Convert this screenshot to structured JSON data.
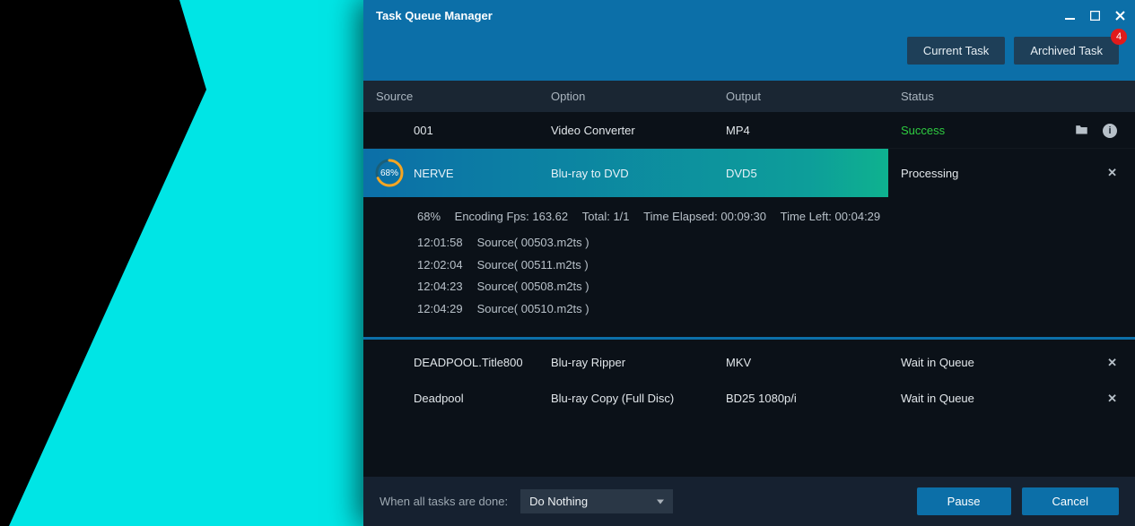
{
  "window": {
    "title": "Task Queue Manager"
  },
  "tabs": {
    "current": "Current Task",
    "archived": "Archived Task",
    "archived_badge": "4"
  },
  "columns": {
    "source": "Source",
    "option": "Option",
    "output": "Output",
    "status": "Status"
  },
  "rows": [
    {
      "source": "001",
      "option": "Video Converter",
      "output": "MP4",
      "status": "Success",
      "status_class": "success",
      "actions": [
        "folder",
        "info"
      ]
    },
    {
      "source": "NERVE",
      "option": "Blu-ray to DVD",
      "output": "DVD5",
      "status": "Processing",
      "processing": true,
      "progress_pct": 68,
      "progress_label": "68%",
      "actions": [
        "close"
      ],
      "details": {
        "stat_pct": "68%",
        "stat_fps": "Encoding Fps: 163.62",
        "stat_total": "Total: 1/1",
        "stat_elapsed": "Time Elapsed: 00:09:30",
        "stat_left": "Time Left: 00:04:29",
        "log": [
          {
            "t": "12:01:58",
            "m": "Source( 00503.m2ts )"
          },
          {
            "t": "12:02:04",
            "m": "Source( 00511.m2ts )"
          },
          {
            "t": "12:04:23",
            "m": "Source( 00508.m2ts )"
          },
          {
            "t": "12:04:29",
            "m": "Source( 00510.m2ts )"
          }
        ]
      }
    },
    {
      "source": "DEADPOOL.Title800",
      "option": "Blu-ray Ripper",
      "output": "MKV",
      "status": "Wait in Queue",
      "actions": [
        "close"
      ]
    },
    {
      "source": "Deadpool",
      "option": "Blu-ray Copy (Full Disc)",
      "output": "BD25 1080p/i",
      "status": "Wait in Queue",
      "actions": [
        "close"
      ]
    }
  ],
  "footer": {
    "when_done_label": "When all tasks are done:",
    "when_done_value": "Do Nothing",
    "pause": "Pause",
    "cancel": "Cancel"
  }
}
